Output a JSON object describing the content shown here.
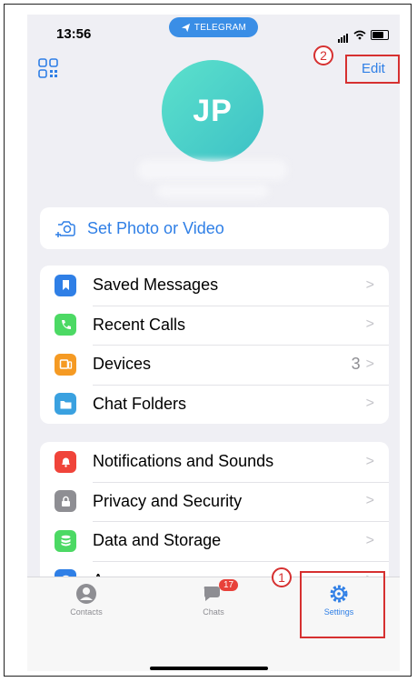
{
  "status_bar": {
    "time": "13:56",
    "app_pill": "TELEGRAM"
  },
  "header": {
    "edit_label": "Edit",
    "avatar_initials": "JP"
  },
  "set_photo": {
    "label": "Set Photo or Video"
  },
  "group1": [
    {
      "label": "Saved Messages",
      "icon": "bookmark-icon",
      "color": "#2f7fe6",
      "value": ""
    },
    {
      "label": "Recent Calls",
      "icon": "phone-icon",
      "color": "#4cd964",
      "value": ""
    },
    {
      "label": "Devices",
      "icon": "devices-icon",
      "color": "#f59a23",
      "value": "3"
    },
    {
      "label": "Chat Folders",
      "icon": "folder-icon",
      "color": "#3aa1e0",
      "value": ""
    }
  ],
  "group2": [
    {
      "label": "Notifications and Sounds",
      "icon": "bell-icon",
      "color": "#f0443a"
    },
    {
      "label": "Privacy and Security",
      "icon": "lock-icon",
      "color": "#8e8e93"
    },
    {
      "label": "Data and Storage",
      "icon": "database-icon",
      "color": "#4cd964"
    },
    {
      "label": "Appearance",
      "icon": "half-circle-icon",
      "color": "#2f7fe6"
    }
  ],
  "tabbar": {
    "contacts_label": "Contacts",
    "chats_label": "Chats",
    "chats_badge": "17",
    "settings_label": "Settings",
    "active_color": "#2f7fe6"
  },
  "annotations": {
    "step1": "1",
    "step2": "2"
  }
}
